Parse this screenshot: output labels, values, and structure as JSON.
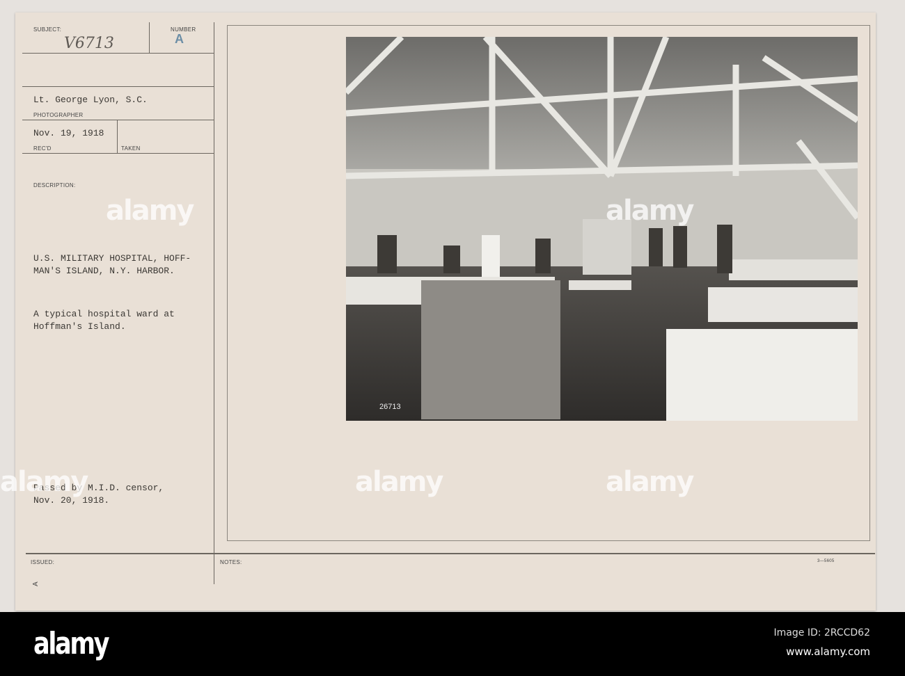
{
  "form": {
    "subject_label": "SUBJECT:",
    "subject_value": "V6713",
    "number_label": "NUMBER",
    "number_value": "A",
    "photographer_value": "Lt. George Lyon, S.C.",
    "photographer_label": "PHOTOGRAPHER",
    "recd_value": "Nov. 19, 1918",
    "recd_label": "REC'D",
    "taken_label": "TAKEN",
    "description_label": "DESCRIPTION:",
    "description_lines": [
      "U.S. MILITARY HOSPITAL, HOFF-",
      "MAN'S ISLAND, N.Y. HARBOR."
    ],
    "caption_lines": [
      "A typical hospital ward at",
      "Hoffman's Island."
    ],
    "censor_lines": [
      "Passed by M.I.D. censor,",
      "Nov. 20, 1918."
    ],
    "issued_label": "ISSUED:",
    "notes_label": "NOTES:",
    "form_code": "3—5605",
    "corner_mark": "A"
  },
  "photo": {
    "negative_number": "26713"
  },
  "watermark": {
    "text": "alamy"
  },
  "footer": {
    "logo": "alamy",
    "image_id": "Image ID: 2RCCD62",
    "url": "www.alamy.com"
  }
}
